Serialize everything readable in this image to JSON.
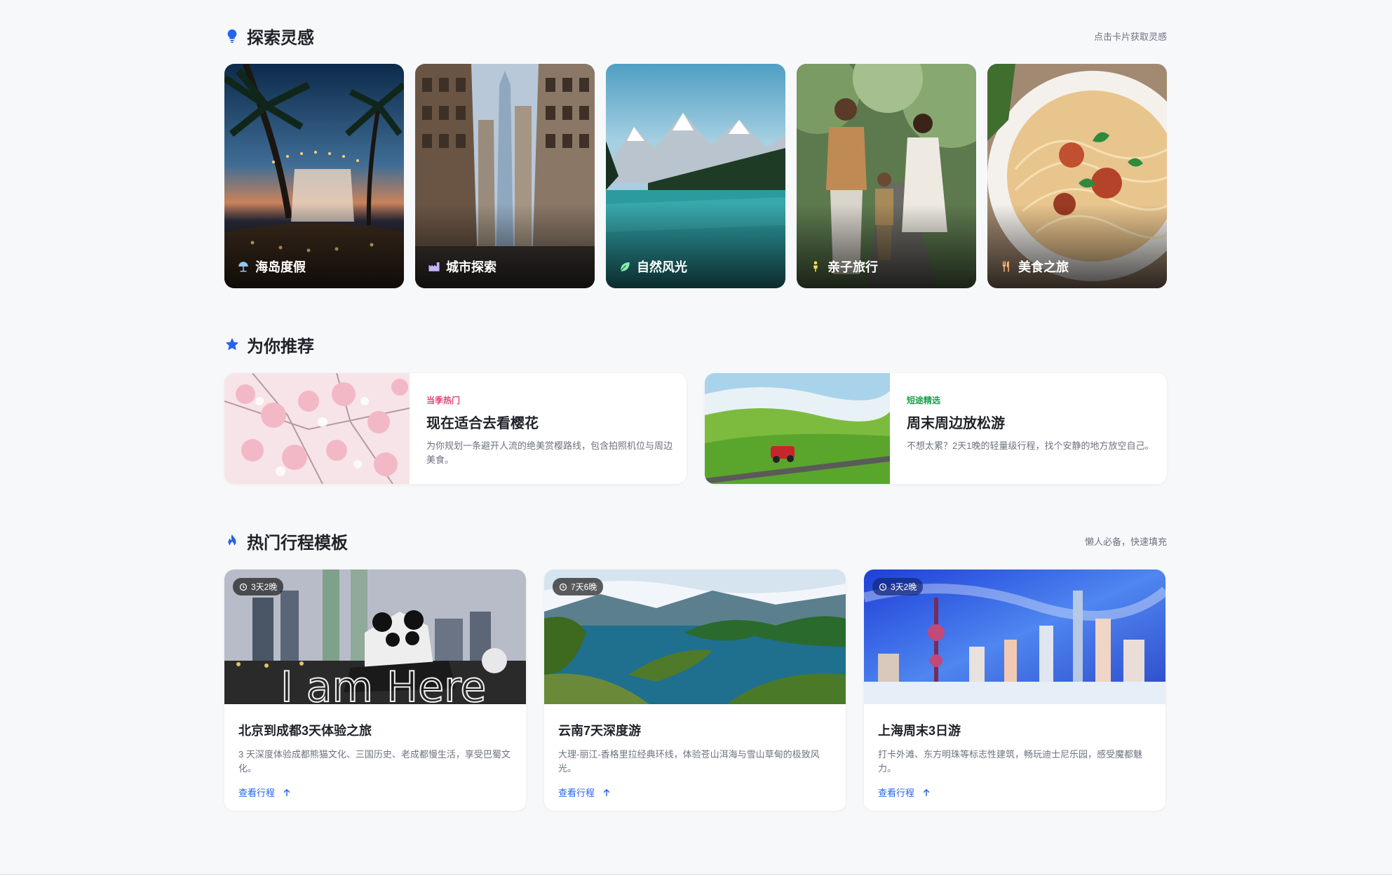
{
  "inspire": {
    "title": "探索灵感",
    "hint": "点击卡片获取灵感",
    "cards": [
      {
        "label": "海岛度假",
        "icon": "beach-umbrella-icon"
      },
      {
        "label": "城市探索",
        "icon": "city-icon"
      },
      {
        "label": "自然风光",
        "icon": "leaf-icon"
      },
      {
        "label": "亲子旅行",
        "icon": "child-icon"
      },
      {
        "label": "美食之旅",
        "icon": "utensils-icon"
      }
    ]
  },
  "recommend": {
    "title": "为你推荐",
    "cards": [
      {
        "tag": "当季热门",
        "tag_color": "#e0457b",
        "title": "现在适合去看樱花",
        "desc": "为你规划一条避开人流的绝美赏樱路线，包含拍照机位与周边美食。"
      },
      {
        "tag": "短途精选",
        "tag_color": "#16a34a",
        "title": "周末周边放松游",
        "desc": "不想太累？2天1晚的轻量级行程，找个安静的地方放空自己。"
      }
    ]
  },
  "templates": {
    "title": "热门行程模板",
    "hint": "懒人必备，快速填充",
    "link_label": "查看行程",
    "cards": [
      {
        "badge": "3天2晚",
        "title": "北京到成都3天体验之旅",
        "desc": "3 天深度体验成都熊猫文化、三国历史、老成都慢生活，享受巴蜀文化。",
        "sign": "I am Here"
      },
      {
        "badge": "7天6晚",
        "title": "云南7天深度游",
        "desc": "大理-丽江-香格里拉经典环线，体验苍山洱海与雪山草甸的极致风光。"
      },
      {
        "badge": "3天2晚",
        "title": "上海周末3日游",
        "desc": "打卡外滩、东方明珠等标志性建筑，畅玩迪士尼乐园，感受魔都魅力。"
      }
    ]
  },
  "colors": {
    "accent": "#2563eb",
    "tag_pink": "#e0457b",
    "tag_green": "#16a34a"
  }
}
